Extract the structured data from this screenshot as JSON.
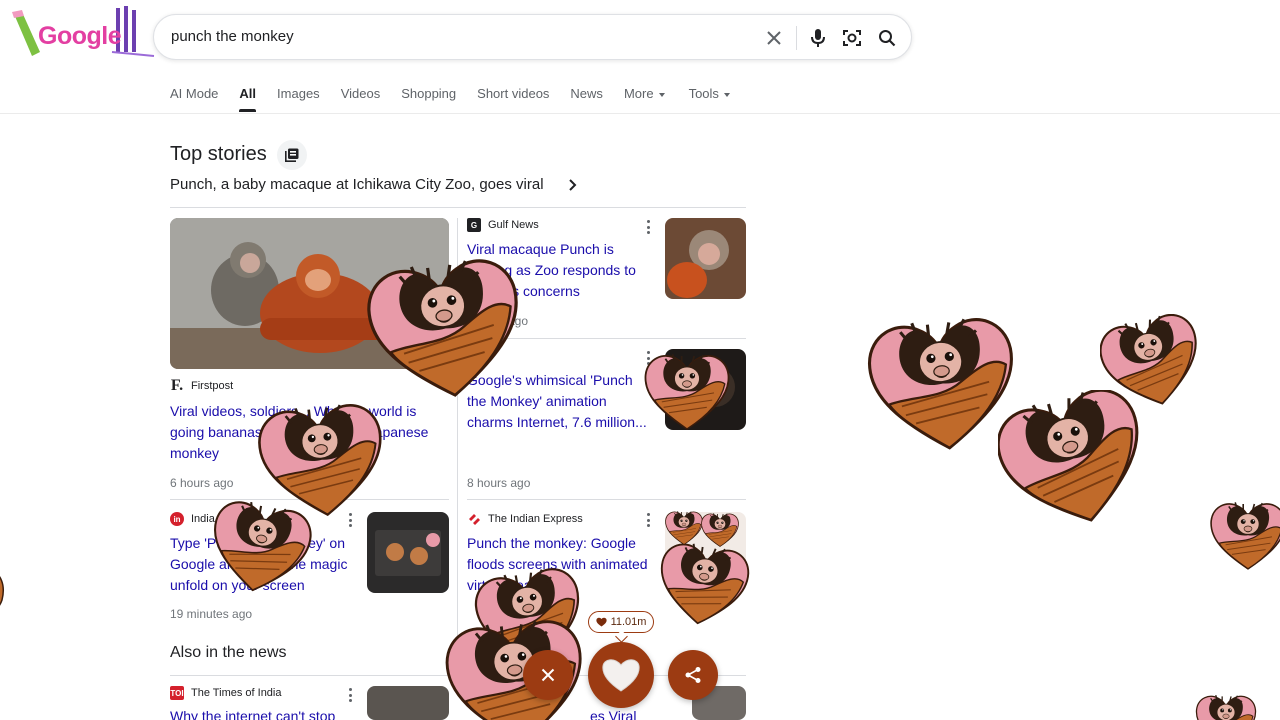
{
  "search": {
    "query": "punch the monkey"
  },
  "logo": {
    "text": "Google"
  },
  "tabs": [
    {
      "label": "AI Mode"
    },
    {
      "label": "All"
    },
    {
      "label": "Images"
    },
    {
      "label": "Videos"
    },
    {
      "label": "Shopping"
    },
    {
      "label": "Short videos"
    },
    {
      "label": "News"
    },
    {
      "label": "More"
    },
    {
      "label": "Tools"
    }
  ],
  "top_stories": {
    "title": "Top stories",
    "subtitle": "Punch, a baby macaque at Ichikawa City Zoo, goes viral",
    "stories": [
      {
        "source": "Firstpost",
        "headline": "Viral videos, soldiers... Why the world is going bananas over Punch, the Japanese monkey",
        "time": "6 hours ago"
      },
      {
        "source": "Gulf News",
        "headline": "Viral macaque Punch is thriving as Zoo responds to hair loss concerns",
        "time": "ago"
      },
      {
        "source": "",
        "headline": "Google's whimsical 'Punch the Monkey' animation charms Internet, 7.6 million...",
        "time": "8 hours ago"
      },
      {
        "source": "India Today",
        "headline": "Type 'Punch the monkey' on Google and watch the magic unfold on your screen",
        "time": "19 minutes ago"
      },
      {
        "source": "The Indian Express",
        "headline": "Punch the monkey: Google floods screens with animated virtual hearts",
        "time": ""
      }
    ]
  },
  "also": {
    "title": "Also in the news",
    "stories": [
      {
        "source": "The Times of India",
        "headline": "Why the internet can't stop"
      },
      {
        "source": "",
        "headline": "es Viral"
      }
    ]
  },
  "reactions": {
    "count": "11.01m"
  },
  "colors": {
    "accent": "#9c3b12",
    "link": "#1a0dab",
    "heart_pink": "#e89aa8",
    "heart_wood": "#b5651d"
  }
}
